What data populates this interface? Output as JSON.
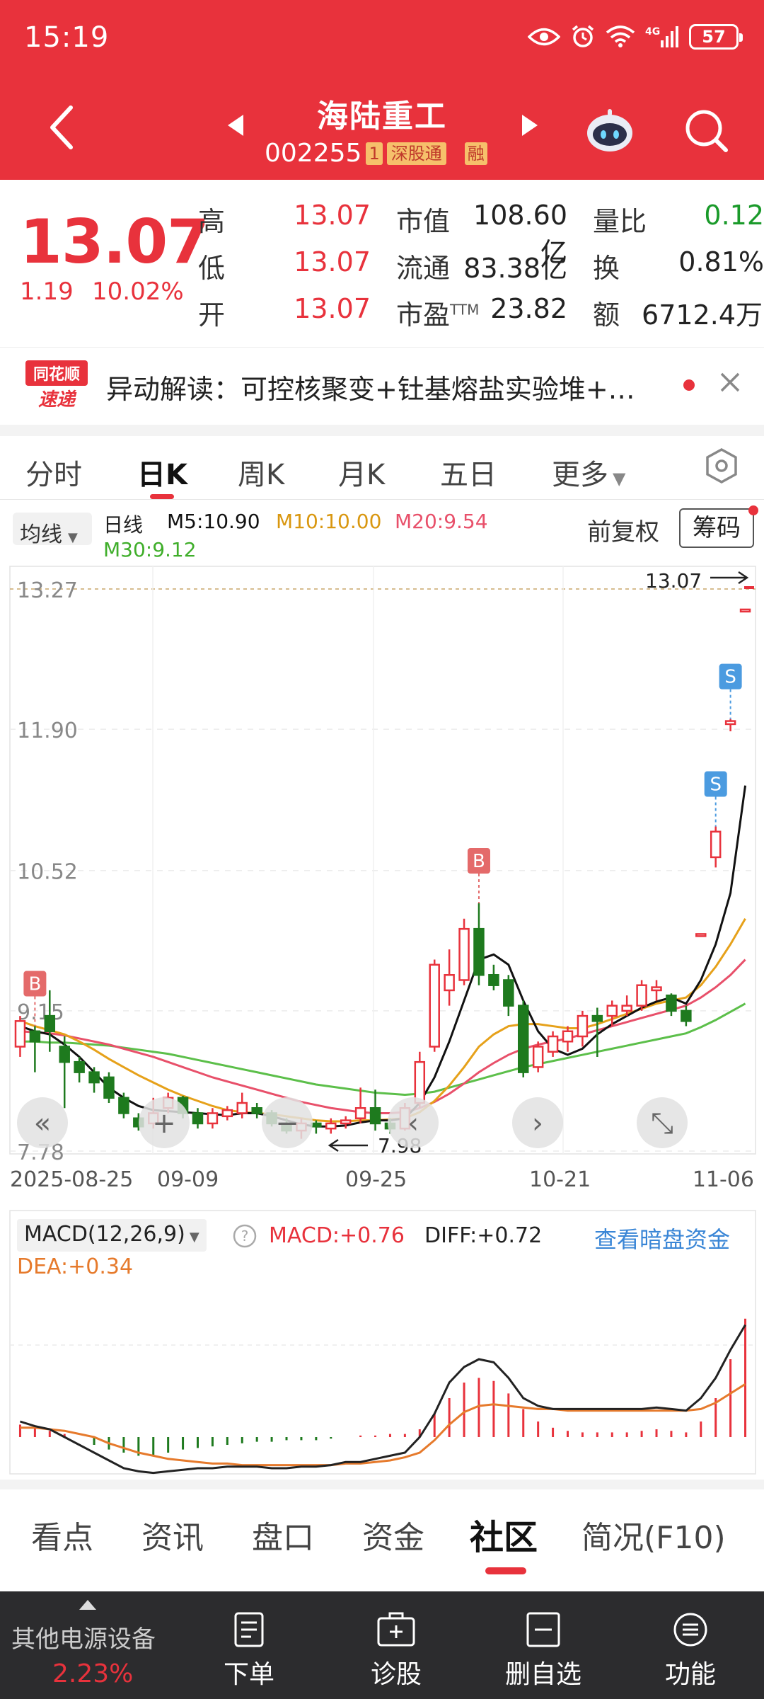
{
  "status": {
    "time": "15:19",
    "battery": "57",
    "network": "4G"
  },
  "header": {
    "name": "海陆重工",
    "code": "002255",
    "tag1": "1",
    "tag2": "深股通",
    "tag3": "融"
  },
  "quote": {
    "price": "13.07",
    "change": "1.19",
    "change_pct": "10.02%",
    "high_label": "高",
    "high": "13.07",
    "low_label": "低",
    "low": "13.07",
    "open_label": "开",
    "open": "13.07",
    "mktcap_label": "市值",
    "mktcap": "108.60亿",
    "float_label": "流通",
    "float": "83.38亿",
    "pe_label": "市盈",
    "pe_sup": "TTM",
    "pe": "23.82",
    "volratio_label": "量比",
    "volratio": "0.12",
    "turnover_label": "换",
    "turnover": "0.81%",
    "amount_label": "额",
    "amount": "6712.4万"
  },
  "news": {
    "logo_line1": "同花顺",
    "logo_line2": "速递",
    "text": "异动解读：可控核聚变+钍基熔盐实验堆+…"
  },
  "ktabs": [
    "分时",
    "日K",
    "周K",
    "月K",
    "五日",
    "更多"
  ],
  "ma": {
    "select": "均线",
    "line_label": "日线",
    "m5": "M5:10.90",
    "m10": "M10:10.00",
    "m20": "M20:9.54",
    "m30": "M30:9.12",
    "fq": "前复权",
    "chip": "筹码"
  },
  "colors": {
    "up": "#e8323c",
    "down": "#1e7a1e",
    "m5": "#111111",
    "m10": "#e6a11a",
    "m20": "#e8506a",
    "m30": "#5cbf4a",
    "header_bg": "#e8323c"
  },
  "chart_data": {
    "type": "candlestick",
    "y_ticks": [
      "13.27",
      "11.90",
      "10.52",
      "9.15",
      "7.78"
    ],
    "ylim": [
      7.78,
      13.27
    ],
    "x_ticks": [
      "2025-08-25",
      "09-09",
      "09-25",
      "10-21",
      "11-06"
    ],
    "last_price_label": "13.07",
    "low_marker_label": "7.98",
    "candles": [
      {
        "o": 8.8,
        "c": 9.05,
        "h": 9.1,
        "l": 8.7
      },
      {
        "o": 8.95,
        "c": 8.85,
        "h": 9.0,
        "l": 8.55
      },
      {
        "o": 9.1,
        "c": 8.95,
        "h": 9.35,
        "l": 8.75
      },
      {
        "o": 8.8,
        "c": 8.65,
        "h": 8.9,
        "l": 8.2
      },
      {
        "o": 8.65,
        "c": 8.55,
        "h": 8.7,
        "l": 8.45
      },
      {
        "o": 8.55,
        "c": 8.45,
        "h": 8.6,
        "l": 8.35
      },
      {
        "o": 8.5,
        "c": 8.3,
        "h": 8.55,
        "l": 8.25
      },
      {
        "o": 8.3,
        "c": 8.15,
        "h": 8.35,
        "l": 8.1
      },
      {
        "o": 8.1,
        "c": 8.02,
        "h": 8.15,
        "l": 7.98
      },
      {
        "o": 8.05,
        "c": 8.15,
        "h": 8.3,
        "l": 8.0
      },
      {
        "o": 8.2,
        "c": 8.3,
        "h": 8.35,
        "l": 8.15
      },
      {
        "o": 8.3,
        "c": 8.15,
        "h": 8.32,
        "l": 8.1
      },
      {
        "o": 8.15,
        "c": 8.05,
        "h": 8.2,
        "l": 8.0
      },
      {
        "o": 8.05,
        "c": 8.15,
        "h": 8.2,
        "l": 8.0
      },
      {
        "o": 8.12,
        "c": 8.18,
        "h": 8.22,
        "l": 8.08
      },
      {
        "o": 8.15,
        "c": 8.25,
        "h": 8.35,
        "l": 8.1
      },
      {
        "o": 8.2,
        "c": 8.15,
        "h": 8.25,
        "l": 8.1
      },
      {
        "o": 8.15,
        "c": 8.05,
        "h": 8.18,
        "l": 8.02
      },
      {
        "o": 8.05,
        "c": 7.98,
        "h": 8.1,
        "l": 7.95
      },
      {
        "o": 7.98,
        "c": 8.05,
        "h": 8.1,
        "l": 7.9
      },
      {
        "o": 8.05,
        "c": 8.02,
        "h": 8.08,
        "l": 7.95
      },
      {
        "o": 8.0,
        "c": 8.05,
        "h": 8.1,
        "l": 7.95
      },
      {
        "o": 8.05,
        "c": 8.08,
        "h": 8.12,
        "l": 8.0
      },
      {
        "o": 8.1,
        "c": 8.2,
        "h": 8.4,
        "l": 8.05
      },
      {
        "o": 8.2,
        "c": 8.05,
        "h": 8.38,
        "l": 7.98
      },
      {
        "o": 8.05,
        "c": 8.0,
        "h": 8.1,
        "l": 7.95
      },
      {
        "o": 8.0,
        "c": 8.2,
        "h": 8.25,
        "l": 7.98
      },
      {
        "o": 8.25,
        "c": 8.65,
        "h": 8.75,
        "l": 8.2
      },
      {
        "o": 8.8,
        "c": 9.6,
        "h": 9.65,
        "l": 8.75
      },
      {
        "o": 9.35,
        "c": 9.5,
        "h": 9.75,
        "l": 9.2
      },
      {
        "o": 9.45,
        "c": 9.95,
        "h": 10.05,
        "l": 9.4
      },
      {
        "o": 9.95,
        "c": 9.5,
        "h": 10.2,
        "l": 9.4
      },
      {
        "o": 9.5,
        "c": 9.4,
        "h": 9.6,
        "l": 9.35
      },
      {
        "o": 9.45,
        "c": 9.2,
        "h": 9.5,
        "l": 9.1
      },
      {
        "o": 9.2,
        "c": 8.55,
        "h": 9.25,
        "l": 8.5
      },
      {
        "o": 8.6,
        "c": 8.8,
        "h": 8.85,
        "l": 8.55
      },
      {
        "o": 8.75,
        "c": 8.9,
        "h": 8.95,
        "l": 8.7
      },
      {
        "o": 8.85,
        "c": 8.95,
        "h": 9.0,
        "l": 8.75
      },
      {
        "o": 8.9,
        "c": 9.1,
        "h": 9.15,
        "l": 8.8
      },
      {
        "o": 9.1,
        "c": 9.05,
        "h": 9.18,
        "l": 8.7
      },
      {
        "o": 9.1,
        "c": 9.2,
        "h": 9.25,
        "l": 9.0
      },
      {
        "o": 9.15,
        "c": 9.2,
        "h": 9.3,
        "l": 9.1
      },
      {
        "o": 9.2,
        "c": 9.4,
        "h": 9.45,
        "l": 9.15
      },
      {
        "o": 9.35,
        "c": 9.38,
        "h": 9.45,
        "l": 9.25
      },
      {
        "o": 9.3,
        "c": 9.15,
        "h": 9.32,
        "l": 9.1
      },
      {
        "o": 9.15,
        "c": 9.05,
        "h": 9.2,
        "l": 9.0
      },
      {
        "o": 9.9,
        "c": 9.9,
        "h": 9.9,
        "l": 9.9
      },
      {
        "o": 10.65,
        "c": 10.9,
        "h": 10.95,
        "l": 10.55
      },
      {
        "o": 11.95,
        "c": 11.98,
        "h": 12.0,
        "l": 11.88
      },
      {
        "o": 13.07,
        "c": 13.07,
        "h": 13.07,
        "l": 13.07
      }
    ],
    "signals": [
      {
        "label": "B",
        "index": 1
      },
      {
        "label": "B",
        "index": 31
      },
      {
        "label": "S",
        "index": 47
      },
      {
        "label": "S",
        "index": 48
      }
    ],
    "ma5": [
      9.0,
      8.95,
      8.92,
      8.82,
      8.7,
      8.55,
      8.4,
      8.3,
      8.22,
      8.18,
      8.17,
      8.16,
      8.15,
      8.14,
      8.13,
      8.15,
      8.15,
      8.12,
      8.08,
      8.04,
      8.02,
      8.02,
      8.03,
      8.06,
      8.08,
      8.08,
      8.1,
      8.25,
      8.5,
      8.85,
      9.25,
      9.65,
      9.7,
      9.6,
      9.25,
      8.95,
      8.78,
      8.72,
      8.78,
      8.92,
      9.02,
      9.1,
      9.18,
      9.24,
      9.28,
      9.22,
      9.45,
      9.8,
      10.3,
      11.35
    ],
    "ma10": [
      9.05,
      9.0,
      8.96,
      8.92,
      8.85,
      8.77,
      8.68,
      8.6,
      8.52,
      8.45,
      8.38,
      8.32,
      8.27,
      8.22,
      8.18,
      8.16,
      8.15,
      8.14,
      8.12,
      8.1,
      8.08,
      8.07,
      8.07,
      8.08,
      8.08,
      8.09,
      8.1,
      8.16,
      8.27,
      8.42,
      8.6,
      8.8,
      8.92,
      9.0,
      9.02,
      9.02,
      9.0,
      8.98,
      8.98,
      9.02,
      9.07,
      9.12,
      9.17,
      9.22,
      9.25,
      9.28,
      9.4,
      9.58,
      9.8,
      10.05
    ],
    "ma20": [
      8.95,
      8.94,
      8.93,
      8.91,
      8.88,
      8.85,
      8.82,
      8.78,
      8.74,
      8.7,
      8.65,
      8.6,
      8.55,
      8.5,
      8.46,
      8.42,
      8.38,
      8.34,
      8.3,
      8.26,
      8.23,
      8.2,
      8.18,
      8.16,
      8.15,
      8.15,
      8.16,
      8.2,
      8.26,
      8.34,
      8.44,
      8.55,
      8.64,
      8.72,
      8.78,
      8.82,
      8.85,
      8.88,
      8.92,
      8.96,
      9.0,
      9.04,
      9.08,
      9.12,
      9.16,
      9.2,
      9.28,
      9.38,
      9.5,
      9.65
    ],
    "ma30": [
      8.85,
      8.85,
      8.84,
      8.84,
      8.83,
      8.82,
      8.81,
      8.79,
      8.77,
      8.75,
      8.73,
      8.7,
      8.67,
      8.64,
      8.61,
      8.58,
      8.55,
      8.52,
      8.49,
      8.46,
      8.43,
      8.41,
      8.39,
      8.37,
      8.35,
      8.34,
      8.33,
      8.34,
      8.36,
      8.4,
      8.44,
      8.48,
      8.52,
      8.56,
      8.6,
      8.63,
      8.66,
      8.69,
      8.72,
      8.75,
      8.78,
      8.81,
      8.84,
      8.87,
      8.9,
      8.93,
      8.99,
      9.06,
      9.14,
      9.22
    ]
  },
  "macd": {
    "name": "MACD(12,26,9)",
    "macd": "MACD:+0.76",
    "diff": "DIFF:+0.72",
    "dea": "DEA:+0.34",
    "link": "查看暗盘资金",
    "hist": [
      0.08,
      0.06,
      0.04,
      0.02,
      0.0,
      -0.05,
      -0.08,
      -0.1,
      -0.12,
      -0.12,
      -0.1,
      -0.08,
      -0.07,
      -0.06,
      -0.05,
      -0.04,
      -0.03,
      -0.03,
      -0.02,
      -0.02,
      -0.02,
      -0.01,
      0.0,
      0.01,
      0.01,
      0.02,
      0.02,
      0.05,
      0.15,
      0.25,
      0.35,
      0.38,
      0.36,
      0.28,
      0.18,
      0.1,
      0.06,
      0.04,
      0.03,
      0.03,
      0.03,
      0.03,
      0.04,
      0.05,
      0.04,
      0.03,
      0.1,
      0.25,
      0.5,
      0.76
    ],
    "diff_line": [
      0.1,
      0.07,
      0.05,
      0.0,
      -0.05,
      -0.1,
      -0.15,
      -0.2,
      -0.22,
      -0.23,
      -0.22,
      -0.21,
      -0.2,
      -0.2,
      -0.19,
      -0.19,
      -0.19,
      -0.2,
      -0.2,
      -0.19,
      -0.19,
      -0.18,
      -0.16,
      -0.16,
      -0.14,
      -0.12,
      -0.1,
      0.0,
      0.15,
      0.35,
      0.45,
      0.5,
      0.48,
      0.38,
      0.25,
      0.2,
      0.18,
      0.18,
      0.18,
      0.18,
      0.18,
      0.18,
      0.18,
      0.19,
      0.18,
      0.17,
      0.25,
      0.38,
      0.56,
      0.72
    ],
    "dea_line": [
      0.06,
      0.06,
      0.05,
      0.04,
      0.02,
      0.0,
      -0.04,
      -0.07,
      -0.1,
      -0.12,
      -0.14,
      -0.15,
      -0.16,
      -0.17,
      -0.17,
      -0.18,
      -0.18,
      -0.18,
      -0.18,
      -0.18,
      -0.18,
      -0.18,
      -0.17,
      -0.17,
      -0.16,
      -0.15,
      -0.13,
      -0.1,
      -0.02,
      0.08,
      0.16,
      0.2,
      0.21,
      0.2,
      0.19,
      0.18,
      0.18,
      0.17,
      0.17,
      0.17,
      0.17,
      0.17,
      0.17,
      0.17,
      0.17,
      0.17,
      0.18,
      0.22,
      0.28,
      0.34
    ]
  },
  "btabs": [
    "看点",
    "资讯",
    "盘口",
    "资金",
    "社区",
    "简况(F10)"
  ],
  "footer": {
    "sector": "其他电源设备",
    "sector_pct": "2.23%",
    "buttons": [
      "下单",
      "诊股",
      "删自选",
      "功能"
    ]
  }
}
